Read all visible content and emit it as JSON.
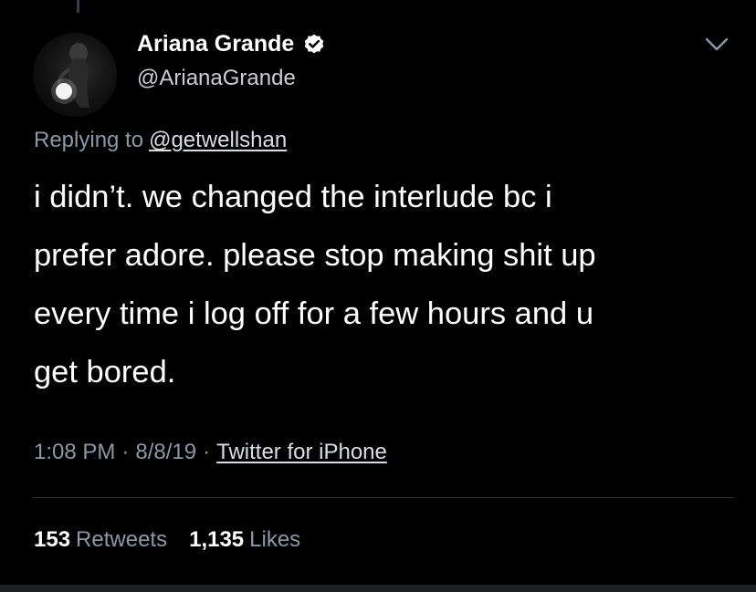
{
  "tweet": {
    "display_name": "Ariana Grande",
    "handle": "@ArianaGrande",
    "replying_prefix": "Replying to",
    "replying_to": "@getwellshan",
    "text_lines": [
      "i didn’t. we changed the interlude bc i",
      "prefer adore. please stop making shit up",
      "every time i log off for a few hours and u",
      "get bored."
    ],
    "time": "1:08 PM",
    "date": "8/8/19",
    "separator": "·",
    "source": "Twitter for iPhone"
  },
  "stats": {
    "retweets_count": "153",
    "retweets_label": "Retweets",
    "likes_count": "1,135",
    "likes_label": "Likes"
  },
  "icons": {
    "verified": "verified-badge-icon",
    "menu": "chevron-down-icon",
    "avatar": "profile-photo"
  },
  "colors": {
    "background": "#000000",
    "primary_text": "#ffffff",
    "secondary_text": "#8b98a5",
    "divider": "#2f3336"
  }
}
